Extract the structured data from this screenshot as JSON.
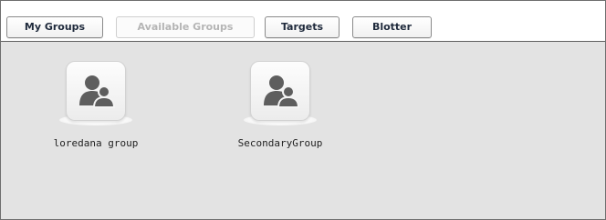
{
  "tabs": [
    {
      "label": "My Groups",
      "state": "normal"
    },
    {
      "label": "Available Groups",
      "state": "disabled"
    },
    {
      "label": "Targets",
      "state": "normal"
    },
    {
      "label": "Blotter",
      "state": "normal"
    }
  ],
  "groups": [
    {
      "name": "loredana group",
      "icon": "group-users-icon"
    },
    {
      "name": "SecondaryGroup",
      "icon": "group-users-icon"
    }
  ],
  "colors": {
    "background": "#e3e3e3",
    "tab_text": "#1f2a3c",
    "tab_disabled_text": "#b5b5b5",
    "icon_fill": "#5e5e5e"
  }
}
